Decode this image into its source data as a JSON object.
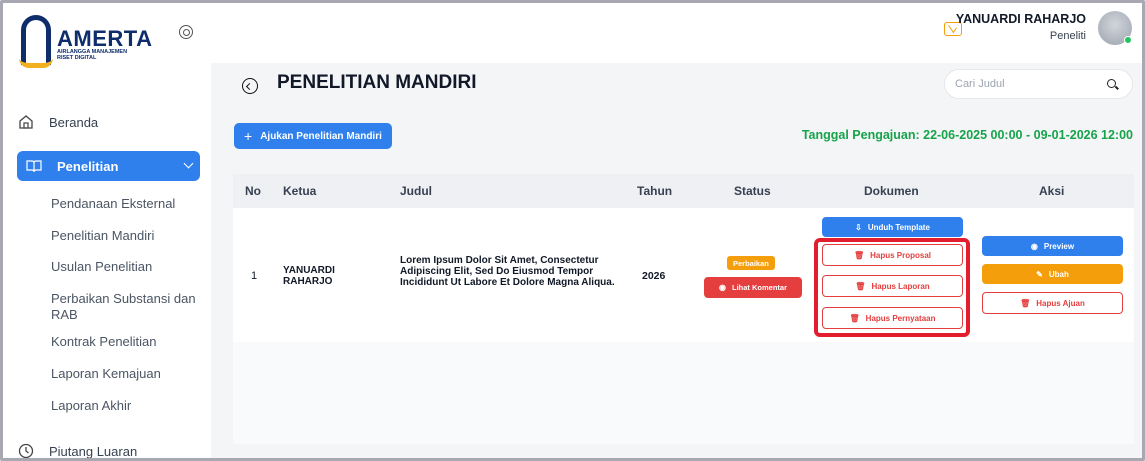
{
  "brand": {
    "name": "AMERTA",
    "tagline_line1": "AIRLANGGA MANAJEMEN",
    "tagline_line2": "RISET DIGITAL"
  },
  "sidebar": {
    "beranda": "Beranda",
    "penelitian": "Penelitian",
    "sub_items": [
      "Pendanaan Eksternal",
      "Penelitian Mandiri",
      "Usulan Penelitian",
      "Perbaikan Substansi dan RAB",
      "Kontrak Penelitian",
      "Laporan Kemajuan",
      "Laporan Akhir"
    ],
    "piutang": "Piutang Luaran"
  },
  "user": {
    "name": "YANUARDI RAHARJO",
    "role": "Peneliti"
  },
  "page": {
    "title": "PENELITIAN MANDIRI",
    "search_placeholder": "Cari Judul",
    "add_button": "Ajukan Penelitian Mandiri",
    "periode": "Tanggal Pengajuan: 22-06-2025 00:00 - 09-01-2026 12:00"
  },
  "table": {
    "headers": [
      "No",
      "Ketua",
      "Judul",
      "Tahun",
      "Status",
      "Dokumen",
      "Aksi"
    ],
    "row": {
      "no": "1",
      "ketua_line1": "YANUARDI",
      "ketua_line2": "RAHARJO",
      "judul": "Lorem Ipsum Dolor Sit Amet, Consectetur Adipiscing Elit, Sed Do Eiusmod Tempor Incididunt Ut Labore Et Dolore Magna Aliqua.",
      "tahun": "2026",
      "status": "Perbaikan",
      "lihat_komentar": "Lihat Komentar",
      "unduh_template": "Unduh Template",
      "hapus_proposal": "Hapus Proposal",
      "hapus_laporan": "Hapus Laporan",
      "hapus_pernyataan": "Hapus Pernyataan",
      "preview": "Preview",
      "ubah": "Ubah",
      "hapus_ajuan": "Hapus Ajuan"
    }
  },
  "colors": {
    "primary": "#2f80ed",
    "warning": "#f59e0b",
    "danger": "#e53e3e",
    "success": "#16a34a",
    "highlight": "#e11d2e"
  }
}
